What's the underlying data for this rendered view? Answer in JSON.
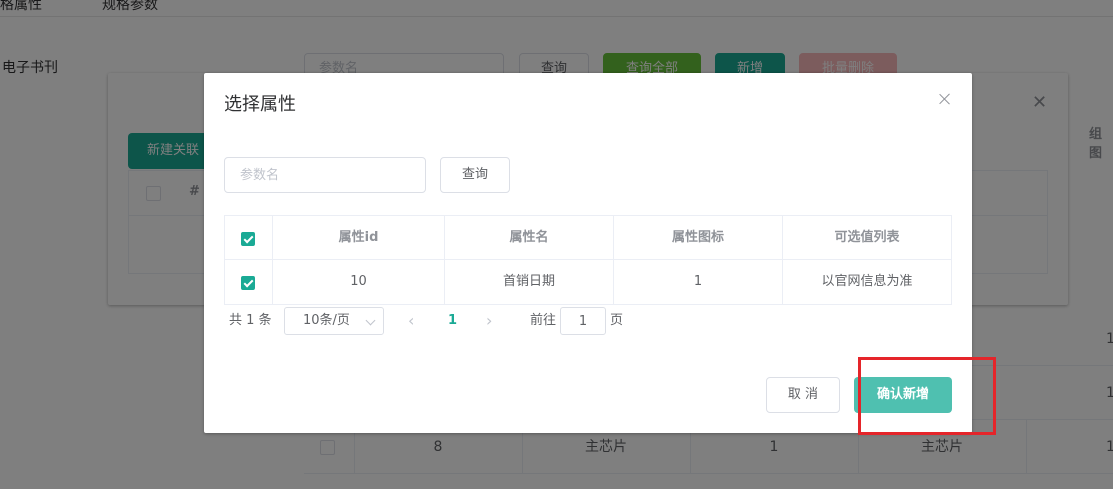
{
  "background": {
    "tabs": [
      "规格属性",
      "规格参数"
    ],
    "side_label": "电子书刊",
    "search_placeholder": "参数名",
    "buttons": {
      "query": "查询",
      "query_all": "查询全部",
      "add": "新增",
      "batch_delete": "批量删除"
    },
    "right_header": "组图",
    "row": {
      "id": "8",
      "name": "主芯片",
      "icon": "1",
      "values": "主芯片"
    },
    "right_numbers": [
      "1",
      "1",
      "1"
    ]
  },
  "middle_dialog": {
    "new_button": "新建关联",
    "hash_header": "#"
  },
  "dialog": {
    "title": "选择属性",
    "search": {
      "placeholder": "参数名",
      "value": ""
    },
    "query_button": "查询",
    "table": {
      "columns": [
        "属性id",
        "属性名",
        "属性图标",
        "可选值列表"
      ],
      "rows": [
        {
          "checked": true,
          "id": "10",
          "name": "首销日期",
          "icon": "1",
          "values": "以官网信息为准"
        }
      ]
    },
    "pagination": {
      "total_text": "共 1 条",
      "page_size": "10条/页",
      "current_page": "1",
      "goto_label": "前往",
      "goto_value": "1",
      "page_suffix": "页"
    },
    "cancel_button": "取 消",
    "confirm_button": "确认新增"
  },
  "colors": {
    "accent": "#1aaa95",
    "confirm": "#4fc0b0",
    "annotation": "#e5252a"
  }
}
